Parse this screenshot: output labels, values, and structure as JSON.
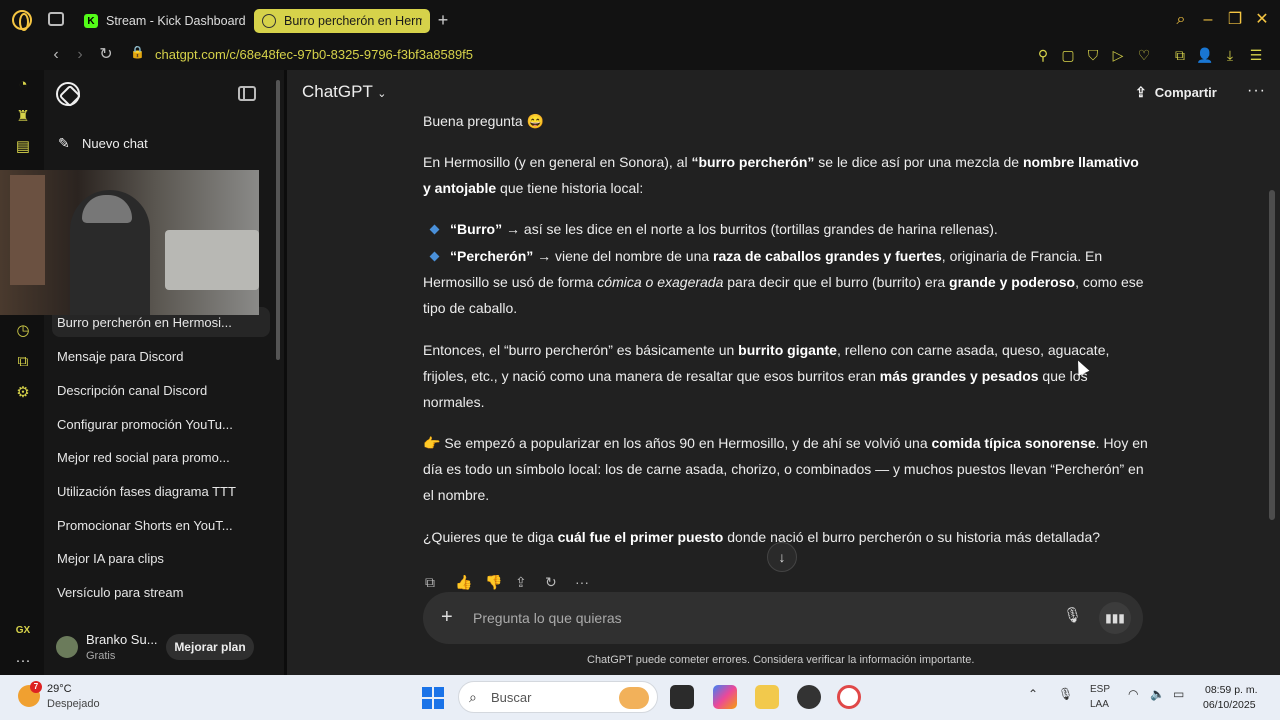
{
  "browser": {
    "tabs": [
      {
        "label": "Stream - Kick Dashboard"
      },
      {
        "label": "Burro percherón en Herm"
      }
    ],
    "url": "chatgpt.com/c/68e48fec-97b0-8325-9796-f3bf3a8589f5",
    "accent_color": "#d6d24a"
  },
  "sidebar": {
    "new_chat": "Nuevo chat",
    "chats": [
      {
        "label": "Burro percherón en Hermosi..."
      },
      {
        "label": "Mensaje para Discord"
      },
      {
        "label": "Descripción canal Discord"
      },
      {
        "label": "Configurar promoción YouTu..."
      },
      {
        "label": "Mejor red social para promo..."
      },
      {
        "label": "Utilización fases diagrama TTT"
      },
      {
        "label": "Promocionar Shorts en YouT..."
      },
      {
        "label": "Mejor IA para clips"
      },
      {
        "label": "Versículo para stream"
      }
    ],
    "user": {
      "name": "Branko Su...",
      "plan": "Gratis",
      "upgrade": "Mejorar plan"
    }
  },
  "header": {
    "model": "ChatGPT",
    "share": "Compartir"
  },
  "message": {
    "p0": "Buena pregunta 😄",
    "p1a": "En Hermosillo (y en general en Sonora), al ",
    "p1b": "“burro percherón”",
    "p1c": " se le dice así por una mezcla de ",
    "p1d": "nombre llamativo y antojable",
    "p1e": " que tiene historia local:",
    "b1a": "“Burro”",
    "b1b": " → así se les dice en el norte a los burritos (tortillas grandes de harina rellenas).",
    "b2a": "“Percherón”",
    "b2b": " → viene del nombre de una ",
    "b2c": "raza de caballos grandes y fuertes",
    "b2d": ", originaria de Francia. En Hermosillo se usó de forma ",
    "b2e": "cómica o exagerada",
    "b2f": " para decir que el burro (burrito) era ",
    "b2g": "grande y poderoso",
    "b2h": ", como ese tipo de caballo.",
    "p3a": "Entonces, el “burro percherón” es básicamente un ",
    "p3b": "burrito gigante",
    "p3c": ", relleno con carne asada, queso, aguacate, frijoles, etc., y nació como una manera de resaltar que esos burritos eran ",
    "p3d": "más grandes y pesados",
    "p3e": " que los normales.",
    "p4a": "👉 Se empezó a popularizar en los años 90 en Hermosillo, y de ahí se volvió una ",
    "p4b": "comida típica sonorense",
    "p4c": ". Hoy en día es todo un símbolo local: los de carne asada, chorizo, o combinados — y muchos puestos llevan “Percherón” en el nombre.",
    "p5a": "¿Quieres que te diga ",
    "p5b": "cuál fue el primer puesto",
    "p5c": " donde nació el burro percherón o su historia más detallada?"
  },
  "composer": {
    "placeholder": "Pregunta lo que quieras"
  },
  "disclaimer": "ChatGPT puede cometer errores. Considera verificar la información importante.",
  "taskbar": {
    "temp": "29°C",
    "weather": "Despejado",
    "weather_badge": "7",
    "search": "Buscar",
    "lang1": "ESP",
    "lang2": "LAA",
    "time": "08:59 p. m.",
    "date": "06/10/2025"
  }
}
